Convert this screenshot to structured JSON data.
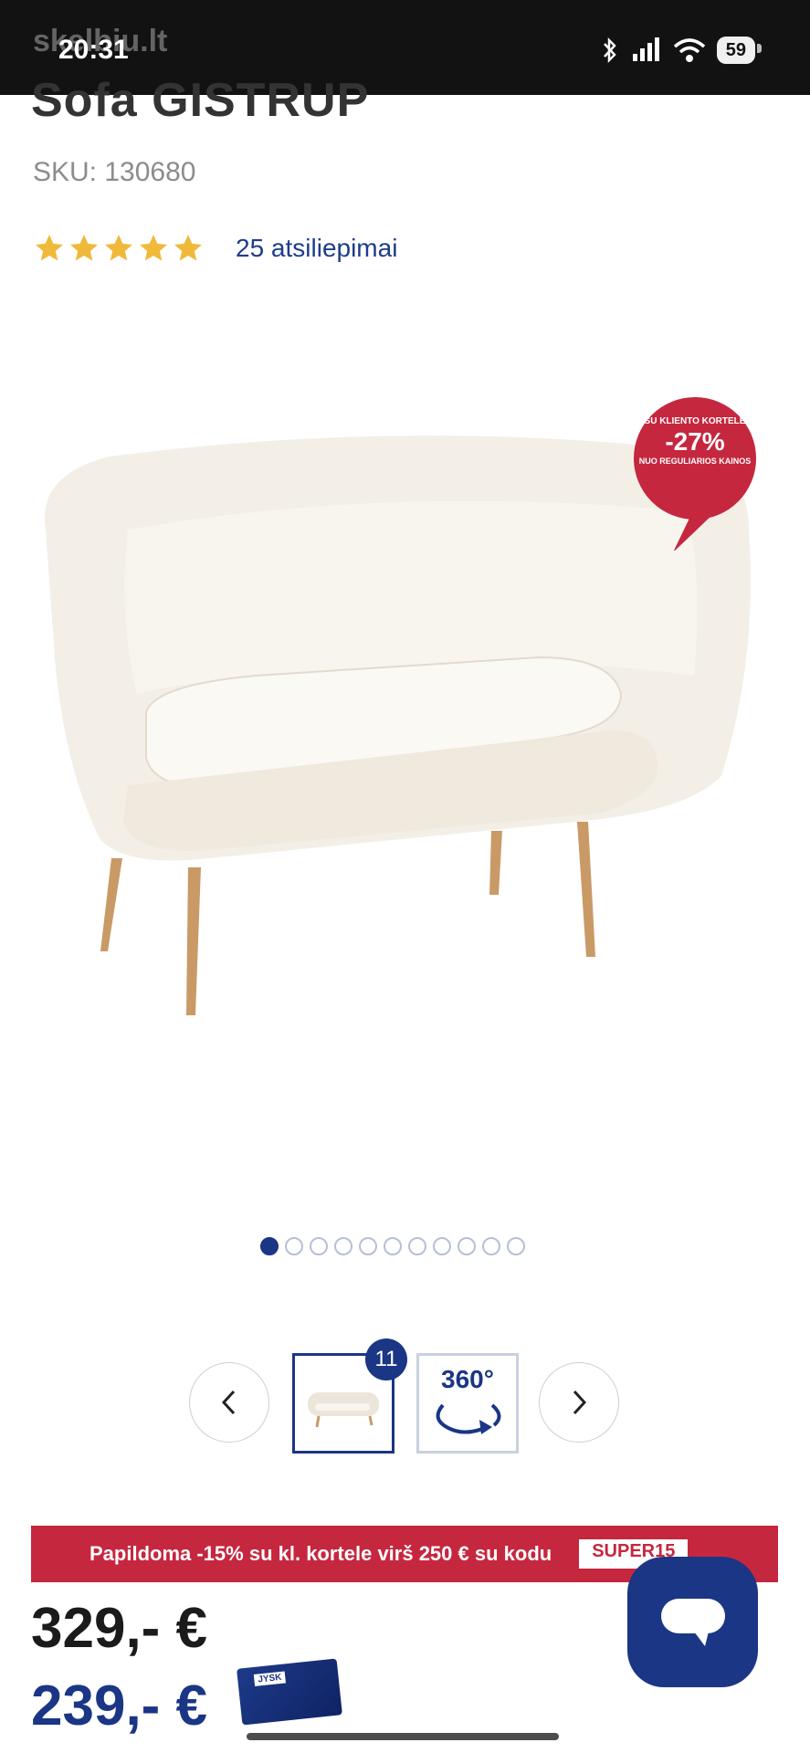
{
  "status_bar": {
    "time": "20:31",
    "watermark": "skelbiu.lt",
    "battery": "59"
  },
  "product": {
    "title_partial": "Sofa GISTRUP",
    "sku": "SKU: 130680",
    "rating_stars": 5,
    "reviews": "25 atsiliepimai"
  },
  "promo_badge": {
    "line1": "SU KLIENTO KORTELE",
    "discount": "-27%",
    "line2": "NUO REGULIARIOS KAINOS"
  },
  "gallery": {
    "total_images": 11,
    "active_index": 0,
    "dots": 11,
    "thumb_count_badge": "11",
    "view360_label": "360°"
  },
  "banner": {
    "text": "Papildoma -15% su kl. kortele virš 250 € su kodu",
    "code": "SUPER15"
  },
  "prices": {
    "regular": "329,-  €",
    "club": "239,- €"
  },
  "colors": {
    "brand_blue": "#1a3685",
    "promo_red": "#c5273f",
    "star_gold": "#f0b93a"
  }
}
